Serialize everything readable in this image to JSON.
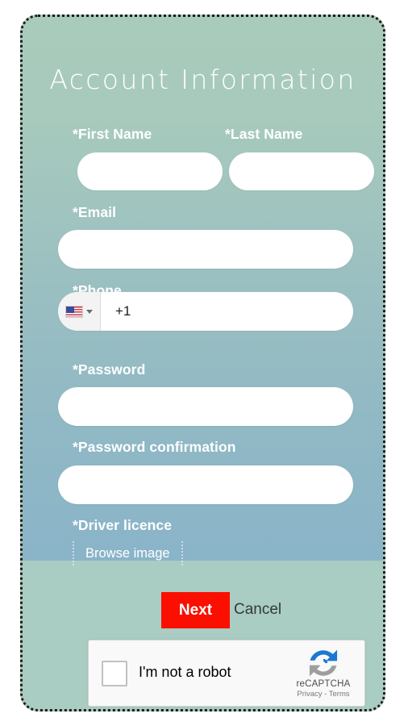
{
  "form": {
    "title": "Account Information",
    "fields": [
      {
        "label": "*First Name",
        "value": "",
        "placeholder": "",
        "name": "first-name"
      },
      {
        "label": "*Last Name",
        "value": "",
        "placeholder": "",
        "name": "last-name"
      },
      {
        "label": "*Email",
        "value": "",
        "placeholder": "",
        "name": "email"
      },
      {
        "label": "*Phone",
        "value": "+1",
        "placeholder": "",
        "name": "phone"
      },
      {
        "label": "*Password",
        "value": "",
        "placeholder": "",
        "name": "password"
      },
      {
        "label": "*Password confirmation",
        "value": "",
        "placeholder": "",
        "name": "password-confirmation"
      },
      {
        "label": "*Driver licence",
        "value": "",
        "placeholder": "",
        "name": "driver-licence"
      }
    ],
    "phone": {
      "country_flag": "us-flag-icon",
      "dial_code": "+1",
      "dropdown_icon": "chevron-down-icon"
    },
    "file_upload": {
      "button_label": "Browse image"
    }
  },
  "footer": {
    "next_label": "Next",
    "cancel_label": "Cancel",
    "next_color": "#fa0f00"
  },
  "recaptcha": {
    "checkbox_label": "I'm not a robot",
    "brand": "reCAPTCHA",
    "links": "Privacy - Terms",
    "logo_icon": "recaptcha-logo-icon",
    "checked": false
  },
  "theme": {
    "gradient_top": "#a9cbbb",
    "gradient_bottom": "#8ab4c8",
    "footer_bg": "#a9cdc2",
    "label_color": "#ffffff",
    "field_bg": "#ffffff",
    "border_color": "#1c1c1c"
  }
}
